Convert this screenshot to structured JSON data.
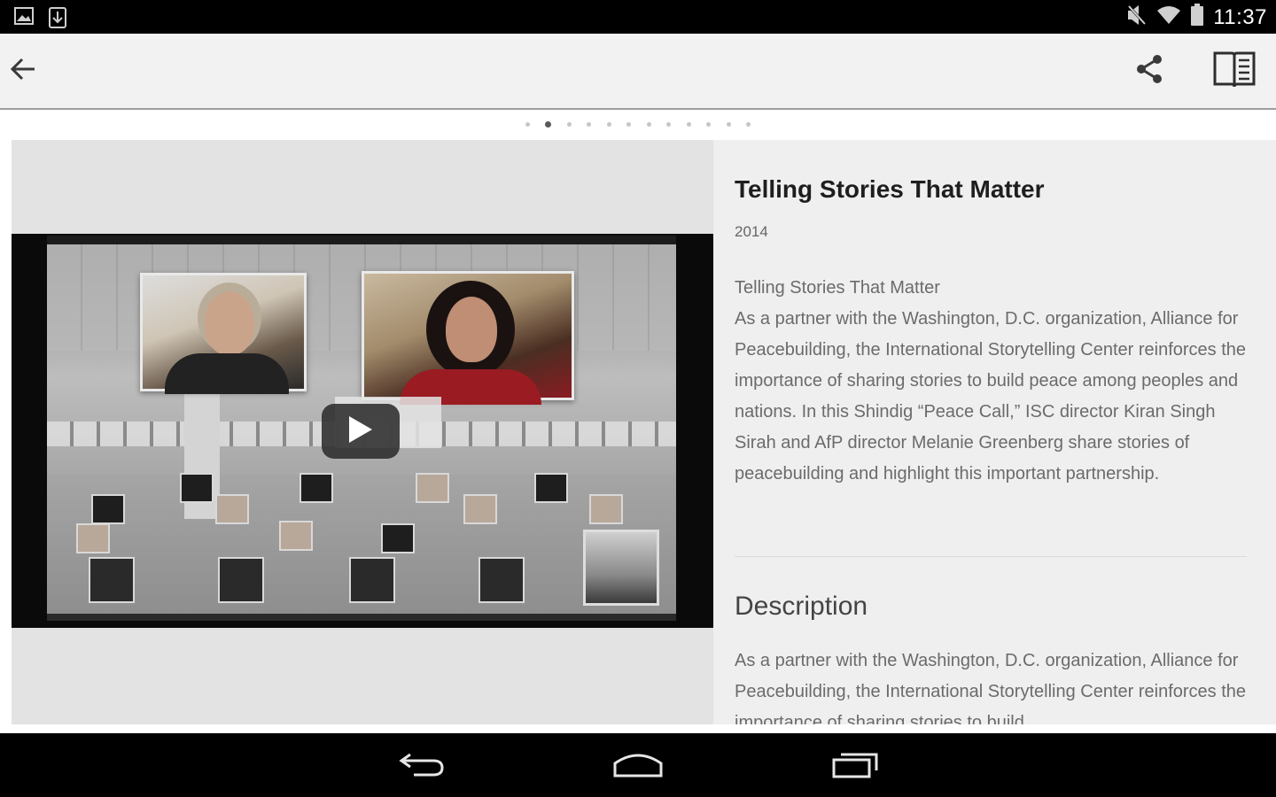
{
  "status_bar": {
    "time": "11:37",
    "left_icons": [
      "image-icon",
      "download-icon"
    ],
    "right_icons": [
      "mute-icon",
      "wifi-icon",
      "battery-icon"
    ]
  },
  "action_bar": {
    "back_icon": "arrow-back-icon",
    "share_icon": "share-icon",
    "book_icon": "open-book-icon"
  },
  "pager": {
    "count": 12,
    "active_index": 1
  },
  "media": {
    "play_icon": "play-icon"
  },
  "detail": {
    "title": "Telling Stories That Matter",
    "year": "2014",
    "summary_title": "Telling Stories That Matter",
    "summary_body": "As a partner with the Washington, D.C. organization, Alliance for Peacebuilding, the International Storytelling Center reinforces the importance of sharing stories to build peace among peoples and nations. In this Shindig “Peace Call,” ISC director Kiran Singh Sirah and AfP director Melanie Greenberg share stories of peacebuilding and highlight this important partnership.",
    "description_heading": "Description",
    "description_body": "As a partner with the Washington, D.C. organization, Alliance for Peacebuilding, the International Storytelling Center reinforces the importance of sharing stories to build"
  },
  "nav_bar": {
    "back_icon": "nav-back-icon",
    "home_icon": "nav-home-icon",
    "recents_icon": "nav-recents-icon"
  },
  "colors": {
    "action_bar_bg": "#f2f2f2",
    "detail_bg": "#efefef",
    "media_bg": "#e3e3e3",
    "text_primary": "#1e1e1e",
    "text_secondary": "#6b6b6b"
  }
}
